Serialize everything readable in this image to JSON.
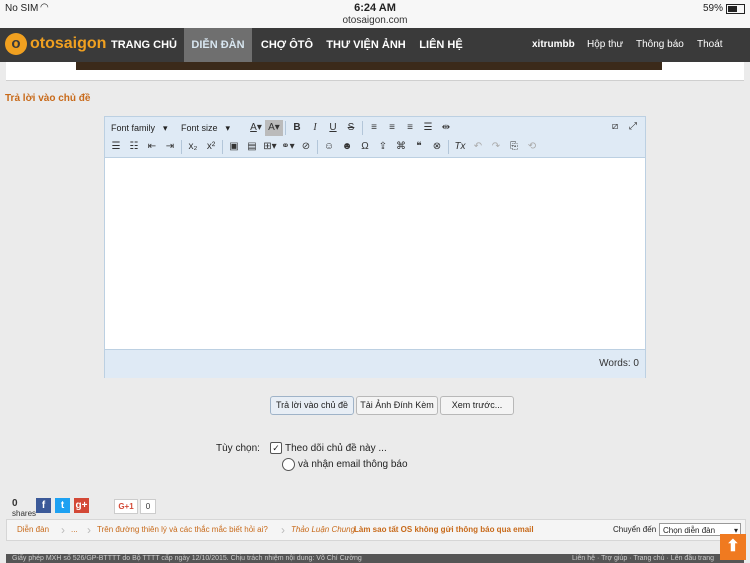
{
  "status_bar": {
    "carrier": "No SIM",
    "time": "6:24 AM",
    "url": "otosaigon.com",
    "battery": "59%"
  },
  "logo": {
    "mark": "o",
    "text": "otosaigon"
  },
  "nav": {
    "items": [
      "TRANG CHỦ",
      "DIỄN ĐÀN",
      "CHỢ ÔTÔ",
      "THƯ VIỆN ẢNH",
      "LIÊN HỆ"
    ],
    "username": "xitrumbb",
    "inbox": "Hộp thư",
    "notifications": "Thông báo",
    "logout": "Thoát"
  },
  "section_title": "Trả lời vào chủ đề",
  "editor": {
    "font_family": "Font family",
    "font_size": "Font size",
    "words": "Words: 0"
  },
  "buttons": {
    "reply": "Trả lời vào chủ đề",
    "upload": "Tải Ảnh Đính Kèm",
    "preview": "Xem trước..."
  },
  "options": {
    "label": "Tùy chọn:",
    "watch": "Theo dõi chủ đề này ...",
    "email": "và nhận email thông báo"
  },
  "share": {
    "count": "0",
    "label": "shares",
    "gplus_count": "0"
  },
  "breadcrumb": {
    "items": [
      "Diễn đàn",
      "...",
      "Trên đường thiên lý và các thắc mắc biết hỏi ai?"
    ],
    "current_prefix": "Thảo Luận Chung",
    "current": "Làm sao tất OS không gửi thông báo qua email",
    "jump_label": "Chuyển đến",
    "jump_value": "Chọn diễn đàn"
  },
  "footer": {
    "left": "Giấy phép MXH số 526/GP-BTTTT do Bộ TTTT cấp ngày 12/10/2015. Chịu trách nhiệm nội dung: Võ Chí Cường",
    "right": "Liên hệ · Trợ giúp · Trang chủ · Lên đầu trang"
  }
}
